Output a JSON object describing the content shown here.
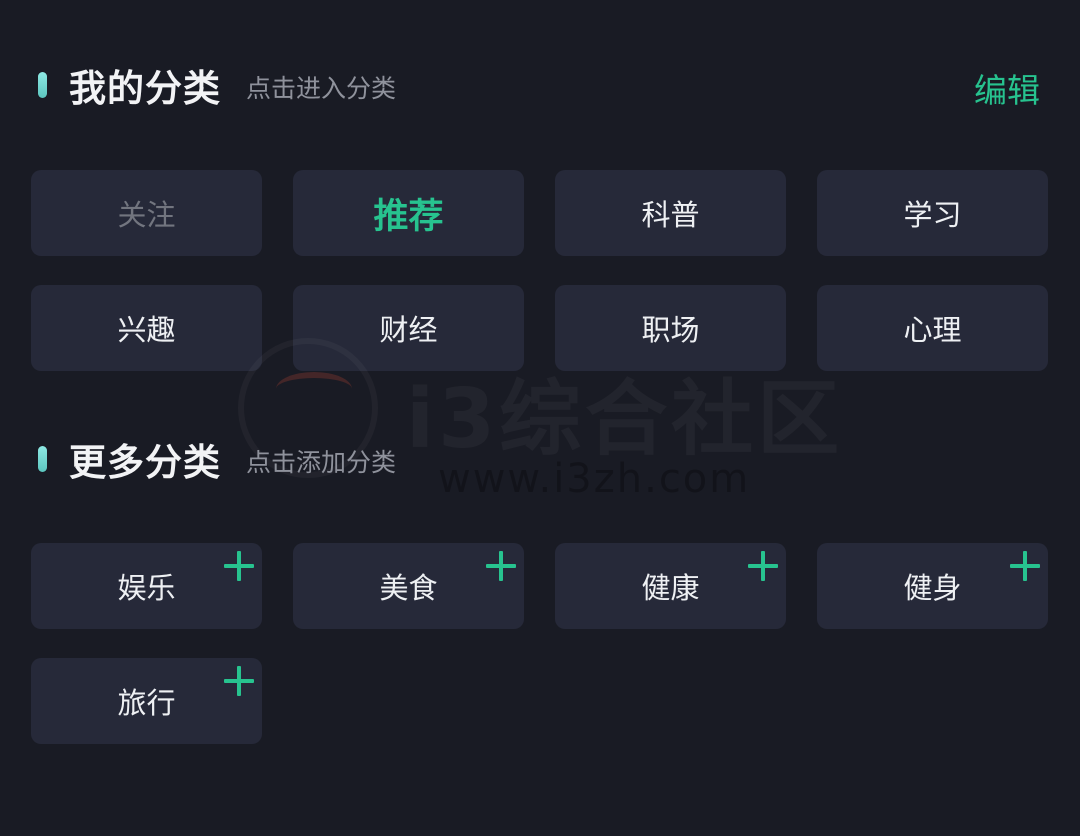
{
  "my_categories": {
    "title": "我的分类",
    "hint": "点击进入分类",
    "edit_label": "编辑",
    "items": [
      {
        "label": "关注",
        "state": "muted"
      },
      {
        "label": "推荐",
        "state": "active"
      },
      {
        "label": "科普",
        "state": "normal"
      },
      {
        "label": "学习",
        "state": "normal"
      },
      {
        "label": "兴趣",
        "state": "normal"
      },
      {
        "label": "财经",
        "state": "normal"
      },
      {
        "label": "职场",
        "state": "normal"
      },
      {
        "label": "心理",
        "state": "normal"
      }
    ]
  },
  "more_categories": {
    "title": "更多分类",
    "hint": "点击添加分类",
    "items": [
      {
        "label": "娱乐",
        "icon": "plus-icon"
      },
      {
        "label": "美食",
        "icon": "plus-icon"
      },
      {
        "label": "健康",
        "icon": "plus-icon"
      },
      {
        "label": "健身",
        "icon": "plus-icon"
      },
      {
        "label": "旅行",
        "icon": "plus-icon"
      }
    ]
  },
  "watermark": {
    "text": "i3综合社区",
    "url": "www.i3zh.com"
  },
  "colors": {
    "background": "#191b24",
    "chip": "#262939",
    "accent": "#27c38f",
    "accent_bar": "#6fd6cf"
  }
}
